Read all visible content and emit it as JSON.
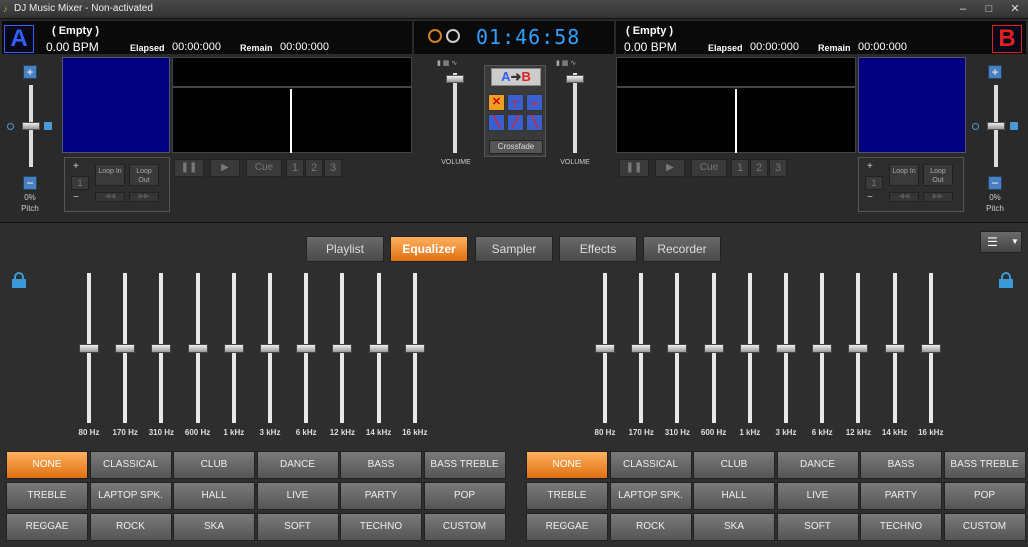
{
  "window": {
    "title": "DJ Music Mixer - Non-activated",
    "min": "–",
    "max": "□",
    "close": "✕"
  },
  "deckA": {
    "letter": "A",
    "track": "( Empty )",
    "bpm": "0.00 BPM",
    "elapsed_label": "Elapsed",
    "elapsed": "00:00:000",
    "remain_label": "Remain",
    "remain": "00:00:000",
    "pitch": "0%",
    "pitch_label": "Pitch",
    "cue": "Cue",
    "hot1": "1",
    "hot2": "2",
    "hot3": "3",
    "loop_in": "Loop In",
    "loop_out": "Loop Out",
    "plus": "+",
    "minus": "−",
    "one": "1"
  },
  "deckB": {
    "letter": "B",
    "track": "( Empty )",
    "bpm": "0.00 BPM",
    "elapsed_label": "Elapsed",
    "elapsed": "00:00:000",
    "remain_label": "Remain",
    "remain": "00:00:000",
    "pitch": "0%",
    "pitch_label": "Pitch",
    "cue": "Cue",
    "hot1": "1",
    "hot2": "2",
    "hot3": "3",
    "loop_in": "Loop In",
    "loop_out": "Loop Out",
    "plus": "+",
    "minus": "−",
    "one": "1"
  },
  "center": {
    "clock": "01:46:58",
    "volume_label": "VOLUME",
    "crossfade": "Crossfade",
    "ab_a": "A",
    "ab_b": "B"
  },
  "tabs": {
    "playlist": "Playlist",
    "equalizer": "Equalizer",
    "sampler": "Sampler",
    "effects": "Effects",
    "recorder": "Recorder"
  },
  "eq": {
    "bands": [
      "80 Hz",
      "170 Hz",
      "310 Hz",
      "600 Hz",
      "1 kHz",
      "3 kHz",
      "6 kHz",
      "12 kHz",
      "14 kHz",
      "16 kHz"
    ],
    "level_fraction": 0.5
  },
  "presets": [
    "NONE",
    "CLASSICAL",
    "CLUB",
    "DANCE",
    "BASS",
    "BASS TREBLE",
    "TREBLE",
    "LAPTOP SPK.",
    "HALL",
    "LIVE",
    "PARTY",
    "POP",
    "REGGAE",
    "ROCK",
    "SKA",
    "SOFT",
    "TECHNO",
    "CUSTOM"
  ],
  "colors": {
    "accent": "#e07010",
    "deckA": "#3060ff",
    "deckB": "#e02020",
    "clock": "#30a0ff"
  }
}
